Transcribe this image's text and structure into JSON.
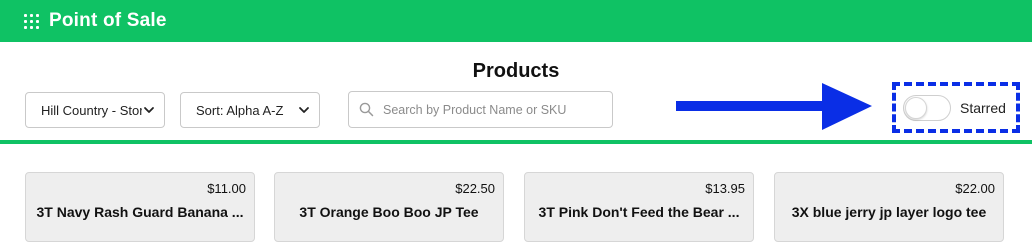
{
  "header": {
    "title": "Point of Sale",
    "icon": "grid-icon",
    "color": "#0fc264"
  },
  "page": {
    "title": "Products"
  },
  "filters": {
    "store": {
      "selected": "Hill Country - Store"
    },
    "sort": {
      "selected": "Sort: Alpha A-Z"
    }
  },
  "search": {
    "placeholder": "Search by Product Name or SKU",
    "value": ""
  },
  "starred": {
    "label": "Starred",
    "enabled": false
  },
  "annotation": {
    "arrow_color": "#0a2ee6",
    "box_style": "dashed"
  },
  "products": [
    {
      "price": "$11.00",
      "name": "3T Navy Rash Guard Banana ..."
    },
    {
      "price": "$22.50",
      "name": "3T Orange Boo Boo JP Tee"
    },
    {
      "price": "$13.95",
      "name": "3T Pink Don't Feed the Bear ..."
    },
    {
      "price": "$22.00",
      "name": "3X blue jerry jp layer logo tee"
    }
  ]
}
